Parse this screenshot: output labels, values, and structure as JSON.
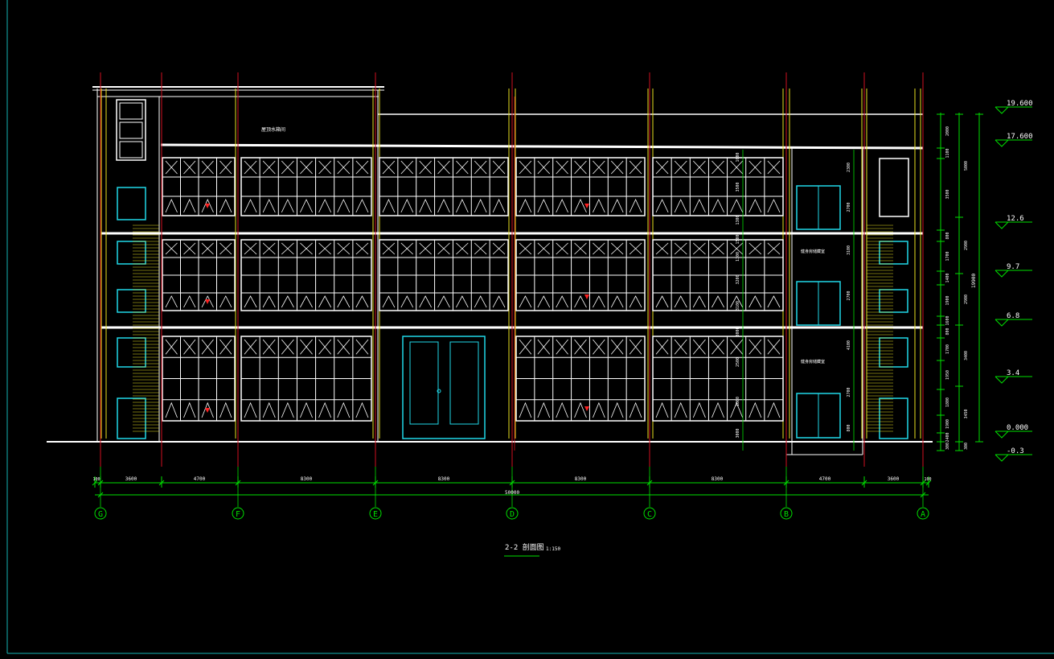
{
  "title": "2-2 剖面图",
  "scale": "1:150",
  "colors": {
    "background": "#000000",
    "frame": "#16b5b5",
    "grid_axis": "#d01020",
    "dimension": "#00e000",
    "walls": "#ffffff",
    "columns": "#e8e020",
    "doors": "#20d8e8",
    "markers": "#ff2020"
  },
  "axes": [
    "G",
    "F",
    "E",
    "D",
    "C",
    "B",
    "A"
  ],
  "bays": [
    "3600",
    "4700",
    "8300",
    "8300",
    "8300",
    "8300",
    "4700",
    "3600"
  ],
  "bay_edges": [
    "100",
    "100"
  ],
  "total_length": "50000",
  "elevations": [
    "19.600",
    "17.600",
    "12.6",
    "9.7",
    "6.8",
    "3.4",
    "0.000",
    "-0.3"
  ],
  "right_dims_inner": [
    "2000",
    "1100",
    "3500",
    "800",
    "1700",
    "1400",
    "1900",
    "1600",
    "800",
    "1700",
    "1950",
    "1800",
    "1900",
    "2400",
    "300"
  ],
  "right_dims_outer": [
    "5000",
    "2900",
    "2900",
    "3400",
    "3450",
    "300"
  ],
  "overall_height": "19900",
  "mid_dims_1": [
    "2300",
    "2700",
    "3100",
    "2700",
    "4100",
    "2700",
    "800"
  ],
  "mid_dims_2": [
    "1600",
    "3500",
    "1300",
    "1500",
    "1300",
    "3200",
    "3100",
    "3000",
    "2500",
    "1000",
    "3000"
  ],
  "room_labels": [
    "屋顶水箱间",
    "健身房储藏室",
    "健身房储藏室"
  ]
}
